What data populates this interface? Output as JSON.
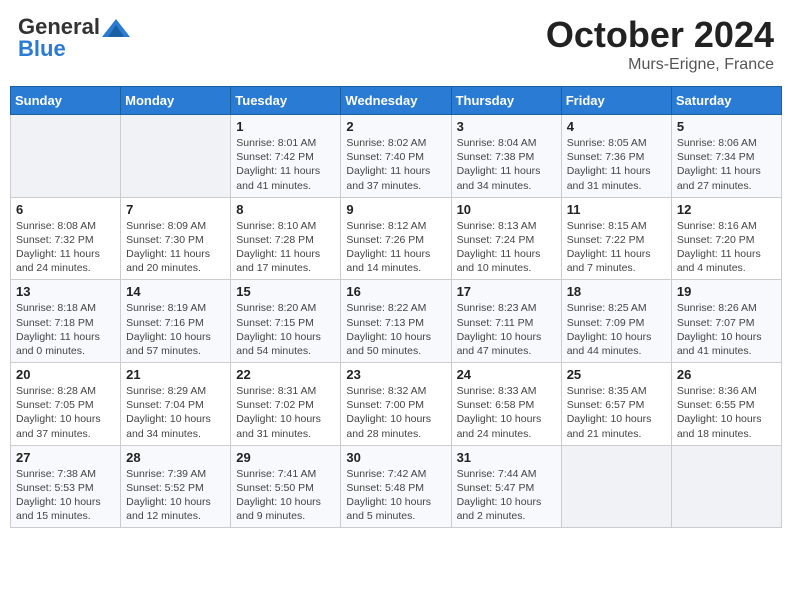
{
  "header": {
    "logo_line1": "General",
    "logo_line2": "Blue",
    "month": "October 2024",
    "location": "Murs-Erigne, France"
  },
  "weekdays": [
    "Sunday",
    "Monday",
    "Tuesday",
    "Wednesday",
    "Thursday",
    "Friday",
    "Saturday"
  ],
  "weeks": [
    [
      {
        "day": "",
        "sunrise": "",
        "sunset": "",
        "daylight": ""
      },
      {
        "day": "",
        "sunrise": "",
        "sunset": "",
        "daylight": ""
      },
      {
        "day": "1",
        "sunrise": "Sunrise: 8:01 AM",
        "sunset": "Sunset: 7:42 PM",
        "daylight": "Daylight: 11 hours and 41 minutes."
      },
      {
        "day": "2",
        "sunrise": "Sunrise: 8:02 AM",
        "sunset": "Sunset: 7:40 PM",
        "daylight": "Daylight: 11 hours and 37 minutes."
      },
      {
        "day": "3",
        "sunrise": "Sunrise: 8:04 AM",
        "sunset": "Sunset: 7:38 PM",
        "daylight": "Daylight: 11 hours and 34 minutes."
      },
      {
        "day": "4",
        "sunrise": "Sunrise: 8:05 AM",
        "sunset": "Sunset: 7:36 PM",
        "daylight": "Daylight: 11 hours and 31 minutes."
      },
      {
        "day": "5",
        "sunrise": "Sunrise: 8:06 AM",
        "sunset": "Sunset: 7:34 PM",
        "daylight": "Daylight: 11 hours and 27 minutes."
      }
    ],
    [
      {
        "day": "6",
        "sunrise": "Sunrise: 8:08 AM",
        "sunset": "Sunset: 7:32 PM",
        "daylight": "Daylight: 11 hours and 24 minutes."
      },
      {
        "day": "7",
        "sunrise": "Sunrise: 8:09 AM",
        "sunset": "Sunset: 7:30 PM",
        "daylight": "Daylight: 11 hours and 20 minutes."
      },
      {
        "day": "8",
        "sunrise": "Sunrise: 8:10 AM",
        "sunset": "Sunset: 7:28 PM",
        "daylight": "Daylight: 11 hours and 17 minutes."
      },
      {
        "day": "9",
        "sunrise": "Sunrise: 8:12 AM",
        "sunset": "Sunset: 7:26 PM",
        "daylight": "Daylight: 11 hours and 14 minutes."
      },
      {
        "day": "10",
        "sunrise": "Sunrise: 8:13 AM",
        "sunset": "Sunset: 7:24 PM",
        "daylight": "Daylight: 11 hours and 10 minutes."
      },
      {
        "day": "11",
        "sunrise": "Sunrise: 8:15 AM",
        "sunset": "Sunset: 7:22 PM",
        "daylight": "Daylight: 11 hours and 7 minutes."
      },
      {
        "day": "12",
        "sunrise": "Sunrise: 8:16 AM",
        "sunset": "Sunset: 7:20 PM",
        "daylight": "Daylight: 11 hours and 4 minutes."
      }
    ],
    [
      {
        "day": "13",
        "sunrise": "Sunrise: 8:18 AM",
        "sunset": "Sunset: 7:18 PM",
        "daylight": "Daylight: 11 hours and 0 minutes."
      },
      {
        "day": "14",
        "sunrise": "Sunrise: 8:19 AM",
        "sunset": "Sunset: 7:16 PM",
        "daylight": "Daylight: 10 hours and 57 minutes."
      },
      {
        "day": "15",
        "sunrise": "Sunrise: 8:20 AM",
        "sunset": "Sunset: 7:15 PM",
        "daylight": "Daylight: 10 hours and 54 minutes."
      },
      {
        "day": "16",
        "sunrise": "Sunrise: 8:22 AM",
        "sunset": "Sunset: 7:13 PM",
        "daylight": "Daylight: 10 hours and 50 minutes."
      },
      {
        "day": "17",
        "sunrise": "Sunrise: 8:23 AM",
        "sunset": "Sunset: 7:11 PM",
        "daylight": "Daylight: 10 hours and 47 minutes."
      },
      {
        "day": "18",
        "sunrise": "Sunrise: 8:25 AM",
        "sunset": "Sunset: 7:09 PM",
        "daylight": "Daylight: 10 hours and 44 minutes."
      },
      {
        "day": "19",
        "sunrise": "Sunrise: 8:26 AM",
        "sunset": "Sunset: 7:07 PM",
        "daylight": "Daylight: 10 hours and 41 minutes."
      }
    ],
    [
      {
        "day": "20",
        "sunrise": "Sunrise: 8:28 AM",
        "sunset": "Sunset: 7:05 PM",
        "daylight": "Daylight: 10 hours and 37 minutes."
      },
      {
        "day": "21",
        "sunrise": "Sunrise: 8:29 AM",
        "sunset": "Sunset: 7:04 PM",
        "daylight": "Daylight: 10 hours and 34 minutes."
      },
      {
        "day": "22",
        "sunrise": "Sunrise: 8:31 AM",
        "sunset": "Sunset: 7:02 PM",
        "daylight": "Daylight: 10 hours and 31 minutes."
      },
      {
        "day": "23",
        "sunrise": "Sunrise: 8:32 AM",
        "sunset": "Sunset: 7:00 PM",
        "daylight": "Daylight: 10 hours and 28 minutes."
      },
      {
        "day": "24",
        "sunrise": "Sunrise: 8:33 AM",
        "sunset": "Sunset: 6:58 PM",
        "daylight": "Daylight: 10 hours and 24 minutes."
      },
      {
        "day": "25",
        "sunrise": "Sunrise: 8:35 AM",
        "sunset": "Sunset: 6:57 PM",
        "daylight": "Daylight: 10 hours and 21 minutes."
      },
      {
        "day": "26",
        "sunrise": "Sunrise: 8:36 AM",
        "sunset": "Sunset: 6:55 PM",
        "daylight": "Daylight: 10 hours and 18 minutes."
      }
    ],
    [
      {
        "day": "27",
        "sunrise": "Sunrise: 7:38 AM",
        "sunset": "Sunset: 5:53 PM",
        "daylight": "Daylight: 10 hours and 15 minutes."
      },
      {
        "day": "28",
        "sunrise": "Sunrise: 7:39 AM",
        "sunset": "Sunset: 5:52 PM",
        "daylight": "Daylight: 10 hours and 12 minutes."
      },
      {
        "day": "29",
        "sunrise": "Sunrise: 7:41 AM",
        "sunset": "Sunset: 5:50 PM",
        "daylight": "Daylight: 10 hours and 9 minutes."
      },
      {
        "day": "30",
        "sunrise": "Sunrise: 7:42 AM",
        "sunset": "Sunset: 5:48 PM",
        "daylight": "Daylight: 10 hours and 5 minutes."
      },
      {
        "day": "31",
        "sunrise": "Sunrise: 7:44 AM",
        "sunset": "Sunset: 5:47 PM",
        "daylight": "Daylight: 10 hours and 2 minutes."
      },
      {
        "day": "",
        "sunrise": "",
        "sunset": "",
        "daylight": ""
      },
      {
        "day": "",
        "sunrise": "",
        "sunset": "",
        "daylight": ""
      }
    ]
  ]
}
